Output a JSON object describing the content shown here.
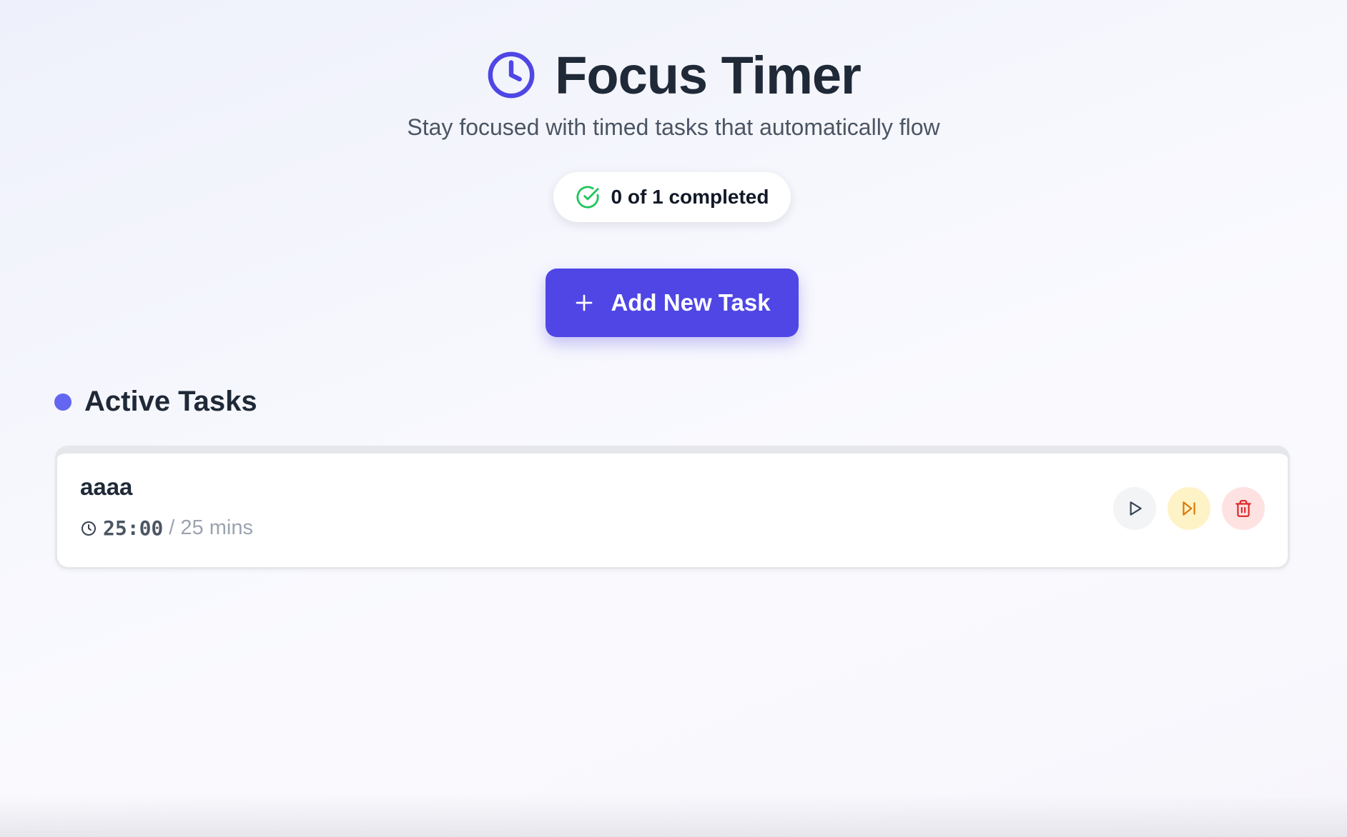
{
  "header": {
    "title": "Focus Timer",
    "subtitle": "Stay focused with timed tasks that automatically flow",
    "icon": "clock-icon"
  },
  "progress": {
    "label": "0 of 1 completed",
    "completed": 0,
    "total": 1,
    "icon": "check-circle-icon"
  },
  "actions": {
    "add_task_label": "Add New Task",
    "add_icon": "plus-icon"
  },
  "active_tasks": {
    "heading": "Active Tasks",
    "tasks": [
      {
        "name": "aaaa",
        "time_remaining": "25:00",
        "duration": "/ 25 mins",
        "progress_fraction": 0,
        "buttons": [
          "play-icon",
          "skip-forward-icon",
          "trash-icon"
        ]
      }
    ]
  },
  "colors": {
    "accent": "#4f46e5",
    "section_dot": "#6366f1",
    "success": "#22c55e",
    "skip": "#d97706",
    "delete": "#dc2626"
  }
}
